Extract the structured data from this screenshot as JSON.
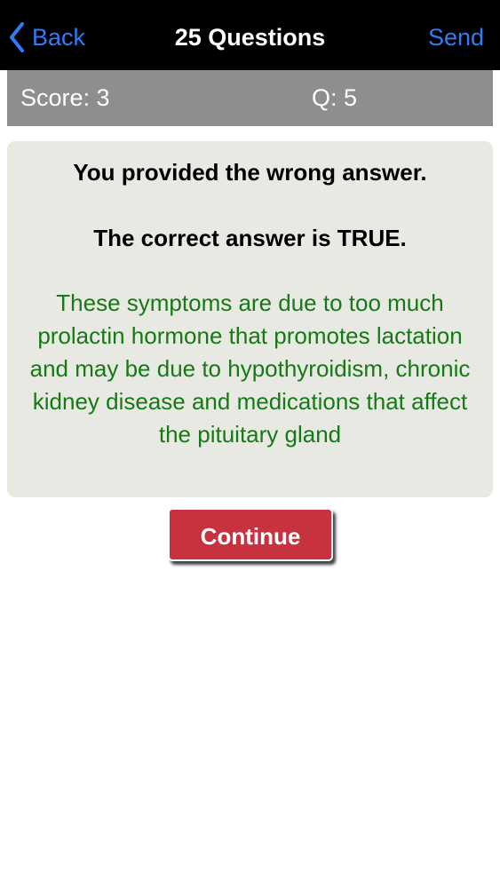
{
  "nav": {
    "back_label": "Back",
    "title": "25 Questions",
    "send_label": "Send"
  },
  "scorebar": {
    "score": "Score: 3",
    "question": "Q: 5"
  },
  "result": {
    "wrong_message": "You provided the wrong answer.",
    "correct_message": "The correct answer is TRUE.",
    "explanation": "These symptoms are due to too much prolactin hormone that promotes lactation and may be due to hypothyroidism, chronic kidney disease and medications that affect the pituitary gland"
  },
  "actions": {
    "continue_label": "Continue"
  },
  "colors": {
    "accent": "#2f7cf6",
    "explanation_text": "#157a15",
    "continue_button": "#c8323f"
  },
  "icons": {
    "back": "chevron-left-icon"
  }
}
